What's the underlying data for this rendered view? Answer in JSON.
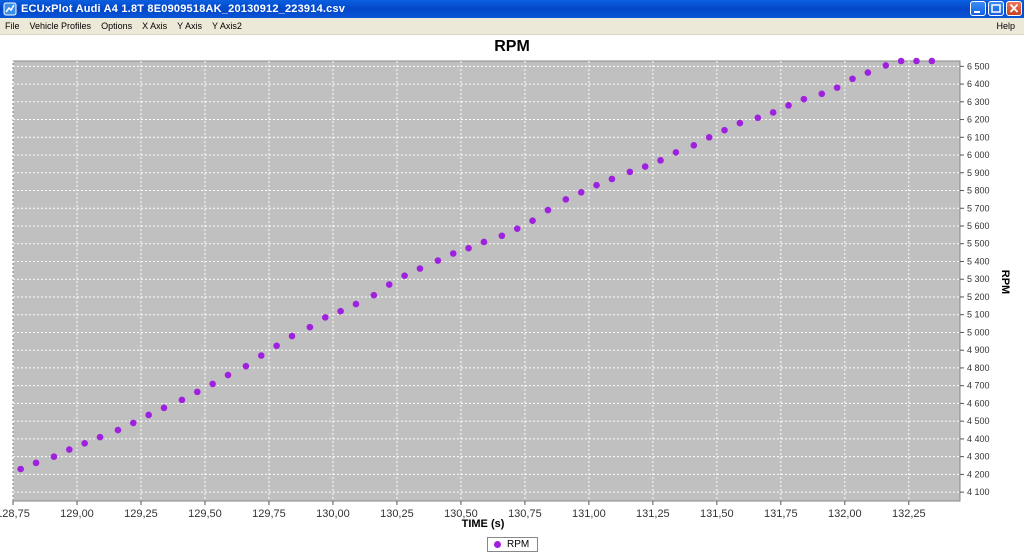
{
  "window": {
    "title": "ECUxPlot Audi A4 1.8T 8E0909518AK_20130912_223914.csv",
    "buttons": [
      "minimize",
      "maximize",
      "close"
    ]
  },
  "menu": {
    "file": "File",
    "vehicle_profiles": "Vehicle Profiles",
    "options": "Options",
    "x_axis": "X Axis",
    "y_axis": "Y Axis",
    "y_axis2": "Y Axis2",
    "help": "Help"
  },
  "colors": {
    "plot_bg": "#c0c0c0",
    "series": "#a020e0",
    "grid": "#ffffff"
  },
  "chart_data": {
    "type": "scatter",
    "title": "RPM",
    "xlabel": "TIME (s)",
    "ylabel": "RPM",
    "y_axis_side": "right",
    "grid": true,
    "legend_position": "bottom",
    "xlim": [
      128.75,
      132.45
    ],
    "ylim": [
      4050,
      6530
    ],
    "x_ticks": [
      128.75,
      129.0,
      129.25,
      129.5,
      129.75,
      130.0,
      130.25,
      130.5,
      130.75,
      131.0,
      131.25,
      131.5,
      131.75,
      132.0,
      132.25
    ],
    "x_tick_labels": [
      "128,75",
      "129,00",
      "129,25",
      "129,50",
      "129,75",
      "130,00",
      "130,25",
      "130,50",
      "130,75",
      "131,00",
      "131,25",
      "131,50",
      "131,75",
      "132,00",
      "132,25"
    ],
    "y_ticks": [
      4100,
      4200,
      4300,
      4400,
      4500,
      4600,
      4700,
      4800,
      4900,
      5000,
      5100,
      5200,
      5300,
      5400,
      5500,
      5600,
      5700,
      5800,
      5900,
      6000,
      6100,
      6200,
      6300,
      6400,
      6500
    ],
    "y_tick_labels": [
      "4 100",
      "4 200",
      "4 300",
      "4 400",
      "4 500",
      "4 600",
      "4 700",
      "4 800",
      "4 900",
      "5 000",
      "5 100",
      "5 200",
      "5 300",
      "5 400",
      "5 500",
      "5 600",
      "5 700",
      "5 800",
      "5 900",
      "6 000",
      "6 100",
      "6 200",
      "6 300",
      "6 400",
      "6 500"
    ],
    "series": [
      {
        "name": "RPM",
        "x": [
          128.78,
          128.84,
          128.91,
          128.97,
          129.03,
          129.09,
          129.16,
          129.22,
          129.28,
          129.34,
          129.41,
          129.47,
          129.53,
          129.59,
          129.66,
          129.72,
          129.78,
          129.84,
          129.91,
          129.97,
          130.03,
          130.09,
          130.16,
          130.22,
          130.28,
          130.34,
          130.41,
          130.47,
          130.53,
          130.59,
          130.66,
          130.72,
          130.78,
          130.84,
          130.91,
          130.97,
          131.03,
          131.09,
          131.16,
          131.22,
          131.28,
          131.34,
          131.41,
          131.47,
          131.53,
          131.59,
          131.66,
          131.72,
          131.78,
          131.84,
          131.91,
          131.97,
          132.03,
          132.09,
          132.16,
          132.22,
          132.28,
          132.34
        ],
        "y": [
          4230,
          4265,
          4300,
          4340,
          4375,
          4410,
          4450,
          4490,
          4535,
          4575,
          4620,
          4665,
          4710,
          4760,
          4810,
          4870,
          4925,
          4980,
          5030,
          5085,
          5120,
          5160,
          5210,
          5270,
          5320,
          5360,
          5405,
          5445,
          5475,
          5510,
          5545,
          5585,
          5630,
          5690,
          5750,
          5790,
          5830,
          5865,
          5905,
          5935,
          5970,
          6015,
          6055,
          6100,
          6140,
          6180,
          6210,
          6240,
          6280,
          6315,
          6345,
          6380,
          6430,
          6465,
          6505,
          6530,
          6530,
          6530
        ]
      }
    ]
  },
  "legend": {
    "label": "RPM"
  }
}
